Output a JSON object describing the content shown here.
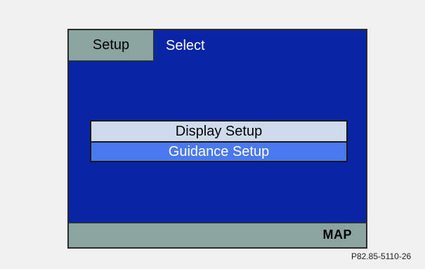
{
  "screen": {
    "tab_label": "Setup",
    "title": "Select",
    "menu": {
      "items": [
        {
          "label": "Display Setup",
          "selected": false
        },
        {
          "label": "Guidance Setup",
          "selected": true
        }
      ]
    },
    "footer": {
      "map_button_label": "MAP"
    },
    "colors": {
      "screen_bg": "#0a24a6",
      "bar_bg": "#8ca49f",
      "item_bg": "#cddbeb",
      "selected_bg": "#4a78ee"
    }
  },
  "caption": "P82.85-5110-26"
}
